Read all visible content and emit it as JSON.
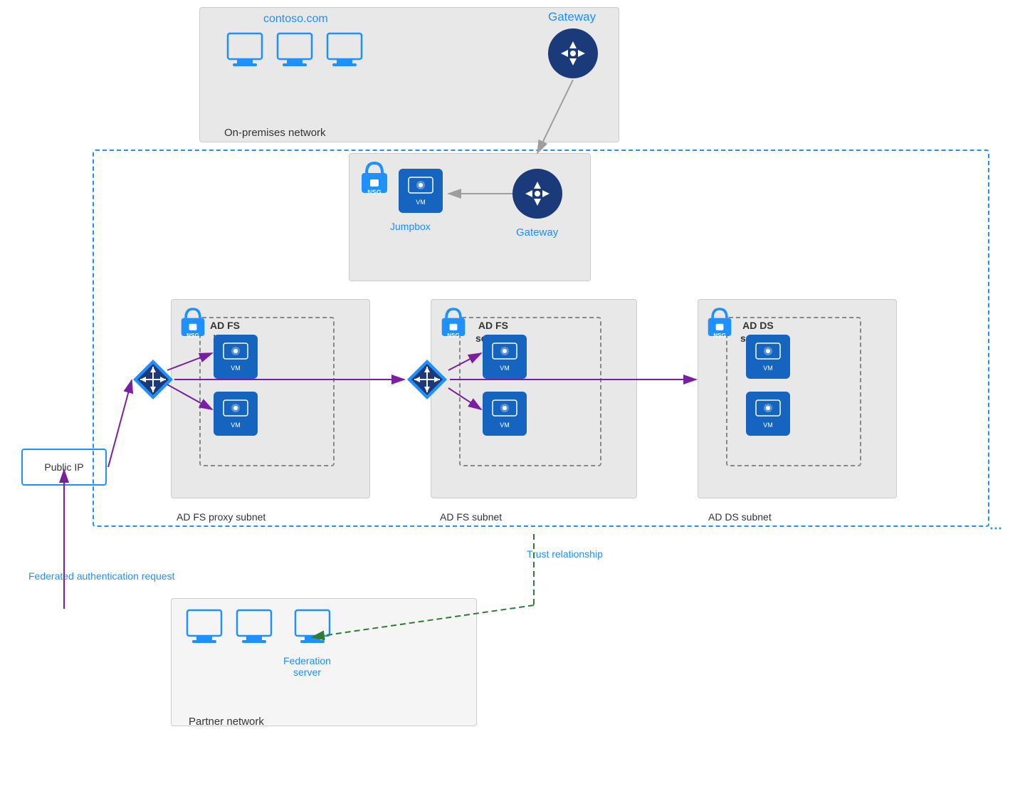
{
  "onprem": {
    "label": "On-premises network",
    "domain": "contoso.com",
    "gateway_label": "Gateway"
  },
  "azure": {
    "gateway_subnet_label": "Gateway",
    "jumpbox_label": "Jumpbox",
    "adfs_proxy_label": "AD FS WAP",
    "adfs_proxy_subnet": "AD FS proxy subnet",
    "adfs_label": "AD FS\nservers",
    "adfs_subnet": "AD FS subnet",
    "adds_label": "AD DS\nservers",
    "adds_subnet": "AD DS subnet"
  },
  "public_ip": "Public IP",
  "trust_label": "Trust relationship",
  "partner": {
    "label": "Partner network",
    "federation_label": "Federation\nserver"
  },
  "federated_auth": "Federated\nauthentication\nrequest",
  "nsg_label": "NSG"
}
